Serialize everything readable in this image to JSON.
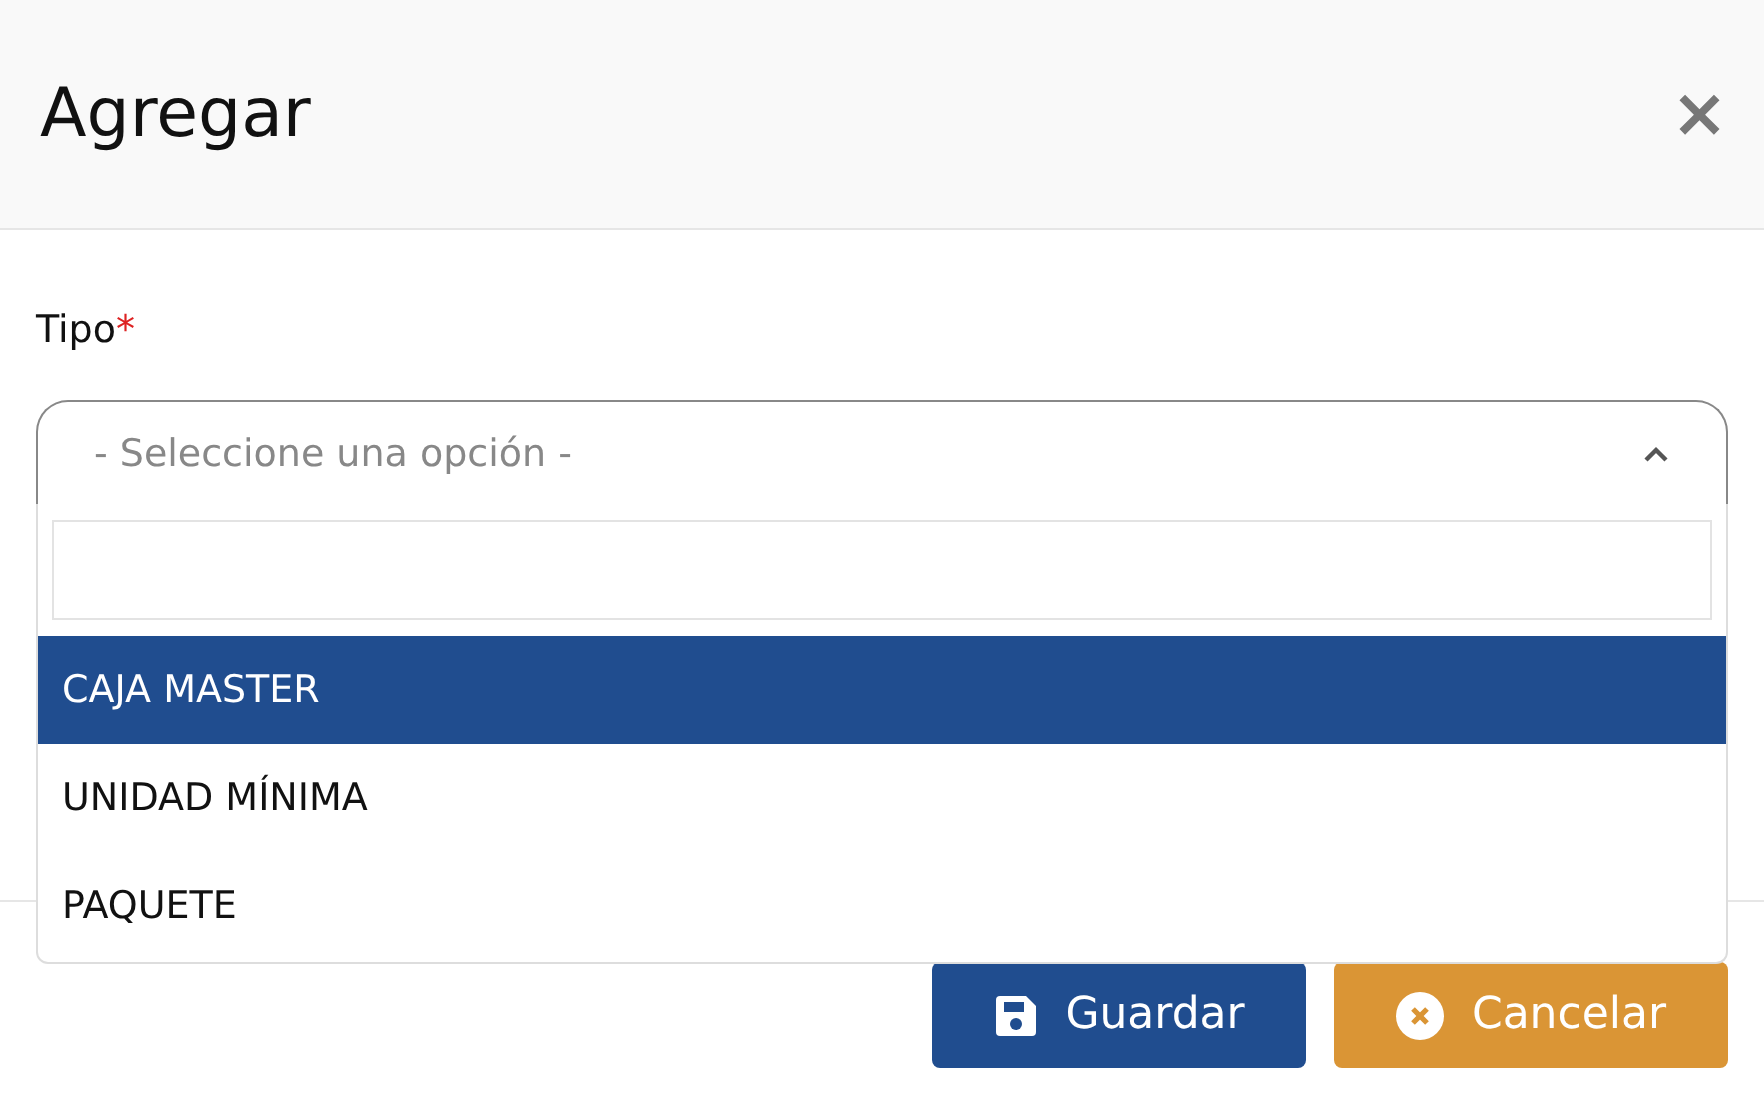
{
  "dialog": {
    "title": "Agregar",
    "close": "×"
  },
  "field": {
    "label": "Tipo",
    "required_mark": "*",
    "placeholder": "- Seleccione una opción -",
    "expanded": true
  },
  "options": [
    {
      "label": "CAJA MASTER",
      "selected": true
    },
    {
      "label": "UNIDAD MÍNIMA",
      "selected": false
    },
    {
      "label": "PAQUETE",
      "selected": false
    }
  ],
  "buttons": [
    {
      "kind": "save",
      "label": "Guardar"
    },
    {
      "kind": "cancel",
      "label": "Cancelar"
    }
  ]
}
